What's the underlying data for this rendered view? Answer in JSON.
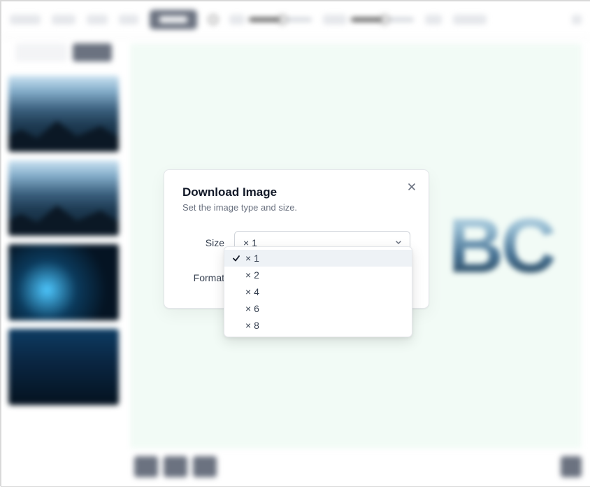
{
  "toolbar": {
    "replace_label": "Replace"
  },
  "modal": {
    "title": "Download Image",
    "subtitle": "Set the image type and size.",
    "size_label": "Size",
    "format_label": "Format",
    "size_selected": "× 1",
    "size_options": [
      "× 1",
      "× 2",
      "× 4",
      "× 6",
      "× 8"
    ]
  },
  "canvas_text": "BC"
}
